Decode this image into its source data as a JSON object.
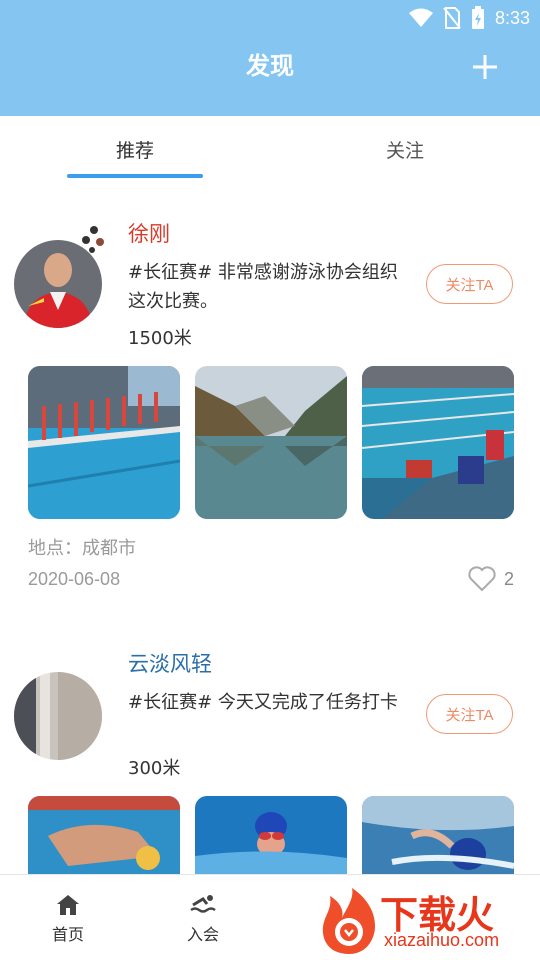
{
  "status_bar": {
    "time": "8:33"
  },
  "header": {
    "title": "发现"
  },
  "tabs": [
    {
      "label": "推荐",
      "active": true
    },
    {
      "label": "关注",
      "active": false
    }
  ],
  "posts": [
    {
      "username": "徐刚",
      "username_color": "#d63a2a",
      "text": "#长征赛# 非常感谢游泳协会组织这次比赛。",
      "distance": "1500米",
      "follow_label": "关注TA",
      "location": "地点：成都市",
      "date": "2020-06-08",
      "likes": "2"
    },
    {
      "username": "云淡风轻",
      "username_color": "#2b6fa8",
      "text": "#长征赛# 今天又完成了任务打卡",
      "distance": "300米",
      "follow_label": "关注TA"
    }
  ],
  "bottom_nav": [
    {
      "label": "首页",
      "icon": "home-icon"
    },
    {
      "label": "入会",
      "icon": "swim-icon"
    }
  ],
  "watermark": {
    "text": "下载火",
    "url": "xiazaihuo.com"
  },
  "colors": {
    "header": "#85c5f1",
    "tab_indicator": "#3b9cf0",
    "follow": "#ee8b64"
  }
}
